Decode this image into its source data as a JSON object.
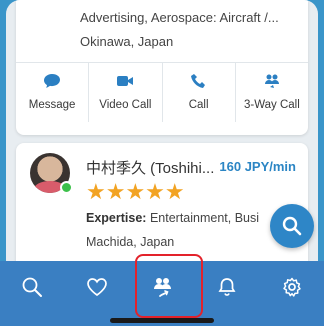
{
  "expert_1": {
    "categories": "Advertising, Aerospace: Aircraft /...",
    "location": "Okinawa, Japan"
  },
  "actions": [
    {
      "label": "Message",
      "icon": "chat-icon"
    },
    {
      "label": "Video Call",
      "icon": "video-icon"
    },
    {
      "label": "Call",
      "icon": "phone-icon"
    },
    {
      "label": "3-Way Call",
      "icon": "group-call-icon"
    }
  ],
  "expert_2": {
    "name": "中村季久 (Toshihi...",
    "rate": "160 JPY/min",
    "stars": "★★★★★",
    "rating": 5,
    "expertise_label": "Expertise:",
    "expertise_value": "Entertainment, Busi",
    "location": "Machida, Japan",
    "online": true
  },
  "tabs": [
    {
      "icon": "search-icon"
    },
    {
      "icon": "heart-icon"
    },
    {
      "icon": "interpreter-icon",
      "highlighted": true
    },
    {
      "icon": "bell-icon"
    },
    {
      "icon": "gear-icon"
    }
  ],
  "colors": {
    "accent": "#2b85c4",
    "tabbar": "#3a7fc2",
    "star": "#f2a323",
    "highlight": "#e3222b",
    "online": "#3cc04a"
  }
}
